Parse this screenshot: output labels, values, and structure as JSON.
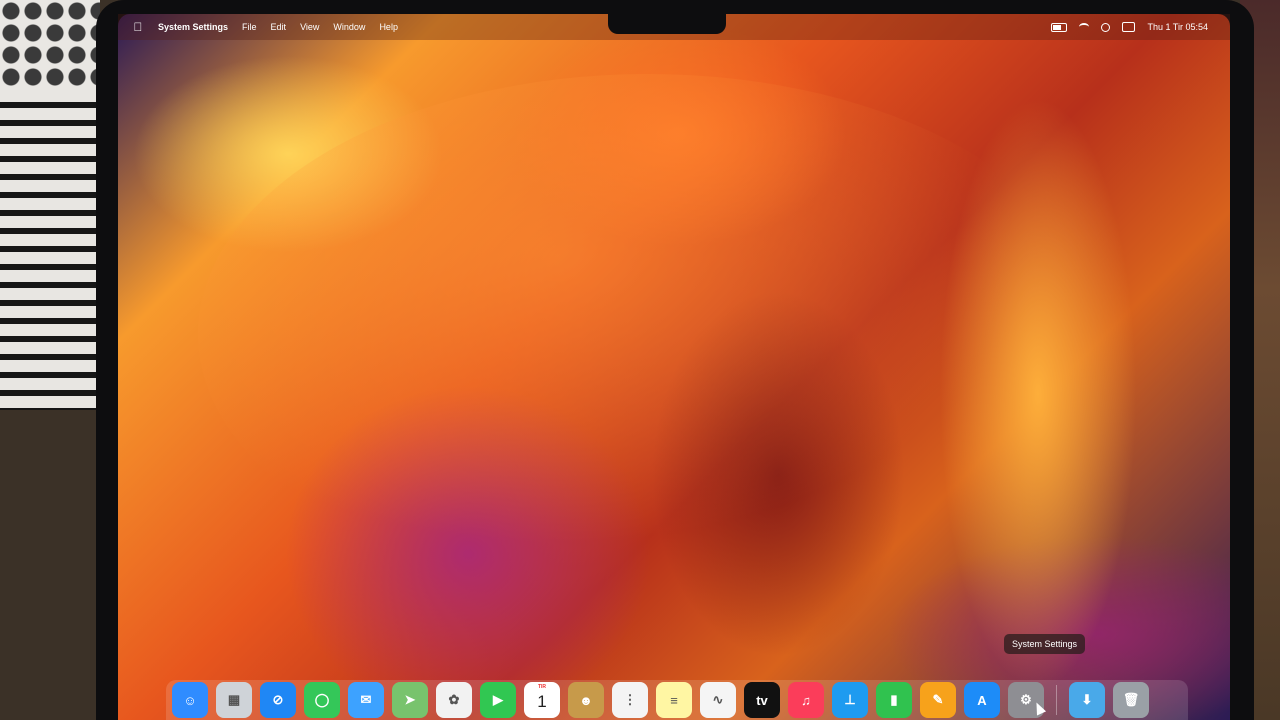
{
  "menubar": {
    "apple_icon": "apple-icon",
    "app_name": "System Settings",
    "menus": [
      "File",
      "Edit",
      "View",
      "Window",
      "Help"
    ],
    "clock": "Thu 1 Tir  05:54"
  },
  "tooltip": "System Settings",
  "dock": {
    "apps": [
      {
        "name": "Finder",
        "icon": "finder-icon",
        "color": "#2f8cff",
        "glyph": "☺"
      },
      {
        "name": "Launchpad",
        "icon": "launchpad-icon",
        "color": "#cfd3d8",
        "glyph": "▦"
      },
      {
        "name": "Safari",
        "icon": "safari-icon",
        "color": "#1f87f5",
        "glyph": "⊘"
      },
      {
        "name": "Messages",
        "icon": "messages-icon",
        "color": "#34c759",
        "glyph": "◯"
      },
      {
        "name": "Mail",
        "icon": "mail-icon",
        "color": "#3da2ff",
        "glyph": "✉"
      },
      {
        "name": "Maps",
        "icon": "maps-icon",
        "color": "#78c36d",
        "glyph": "➤"
      },
      {
        "name": "Photos",
        "icon": "photos-icon",
        "color": "#f2f2f2",
        "glyph": "✿"
      },
      {
        "name": "FaceTime",
        "icon": "facetime-icon",
        "color": "#31c752",
        "glyph": "▶"
      },
      {
        "name": "Calendar",
        "icon": "calendar-icon",
        "color": "#ffffff",
        "glyph": ""
      },
      {
        "name": "Contacts",
        "icon": "contacts-icon",
        "color": "#c79a4a",
        "glyph": "☻"
      },
      {
        "name": "Reminders",
        "icon": "reminders-icon",
        "color": "#f4f4f4",
        "glyph": "⋮"
      },
      {
        "name": "Notes",
        "icon": "notes-icon",
        "color": "#fff6a3",
        "glyph": "≡"
      },
      {
        "name": "Freeform",
        "icon": "freeform-icon",
        "color": "#f5f5f5",
        "glyph": "∿"
      },
      {
        "name": "TV",
        "icon": "apple-tv-icon",
        "color": "#111111",
        "glyph": "tv"
      },
      {
        "name": "Music",
        "icon": "music-icon",
        "color": "#fb3d5a",
        "glyph": "♫"
      },
      {
        "name": "Keynote",
        "icon": "keynote-icon",
        "color": "#1e9bf0",
        "glyph": "⊥"
      },
      {
        "name": "Numbers",
        "icon": "numbers-icon",
        "color": "#30c24f",
        "glyph": "▮"
      },
      {
        "name": "Pages",
        "icon": "pages-icon",
        "color": "#f7a21b",
        "glyph": "✎"
      },
      {
        "name": "App Store",
        "icon": "app-store-icon",
        "color": "#1d8cf8",
        "glyph": "A"
      },
      {
        "name": "System Settings",
        "icon": "system-settings-icon",
        "color": "#8e8e93",
        "glyph": "⚙"
      }
    ],
    "calendar": {
      "month": "TIR",
      "day": "1"
    },
    "extras": [
      {
        "name": "Downloads",
        "icon": "downloads-folder-icon",
        "color": "#49a9e9",
        "glyph": "⬇"
      },
      {
        "name": "Trash",
        "icon": "trash-icon",
        "color": "#9aa0a6",
        "glyph": "🗑"
      }
    ]
  }
}
